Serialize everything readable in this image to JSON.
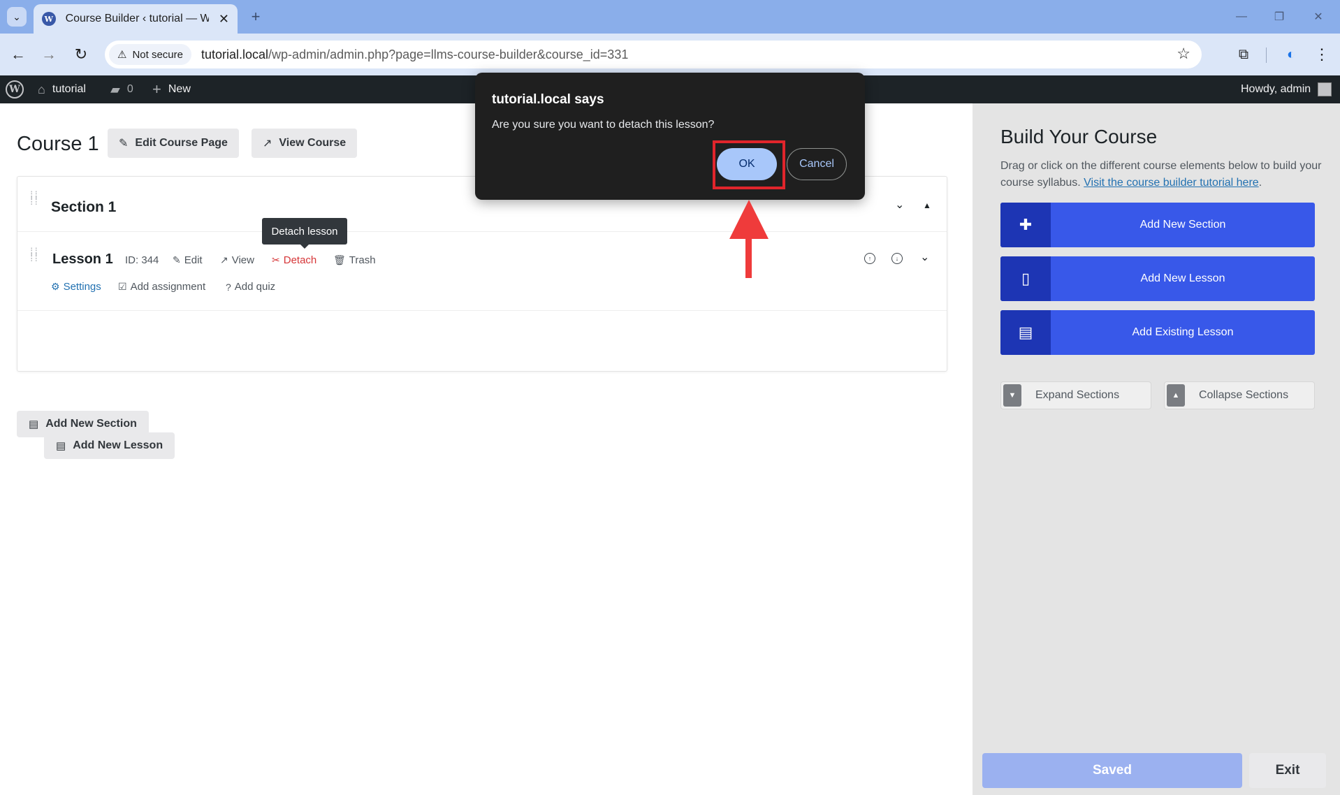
{
  "browser": {
    "tab_title": "Course Builder ‹ tutorial — Wor",
    "security_label": "Not secure",
    "url_host": "tutorial.local",
    "url_path": "/wp-admin/admin.php?page=llms-course-builder&course_id=331"
  },
  "adminbar": {
    "site_name": "tutorial",
    "comments_count": "0",
    "new_label": "New",
    "greeting": "Howdy, admin"
  },
  "course": {
    "title": "Course 1",
    "edit_page_label": "Edit Course Page",
    "view_course_label": "View Course"
  },
  "section": {
    "title": "Section 1",
    "lesson": {
      "title": "Lesson 1",
      "id_text": "ID: 344",
      "edit_label": "Edit",
      "view_label": "View",
      "detach_label": "Detach",
      "trash_label": "Trash",
      "settings_label": "Settings",
      "assignment_label": "Add assignment",
      "quiz_label": "Add quiz"
    },
    "add_lesson_label": "Add New Lesson"
  },
  "tooltip": "Detach lesson",
  "add_section_label": "Add New Section",
  "sidebar": {
    "title": "Build Your Course",
    "description": "Drag or click on the different course elements below to build your course syllabus. ",
    "tutorial_link": "Visit the course builder tutorial here",
    "description_end": ".",
    "buttons": [
      {
        "label": "Add New Section",
        "icon": "puzzle-icon"
      },
      {
        "label": "Add New Lesson",
        "icon": "file-icon"
      },
      {
        "label": "Add Existing Lesson",
        "icon": "file-text-icon"
      }
    ],
    "expand_label": "Expand Sections",
    "collapse_label": "Collapse Sections",
    "saved_label": "Saved",
    "exit_label": "Exit"
  },
  "dialog": {
    "title": "tutorial.local says",
    "message": "Are you sure you want to detach this lesson?",
    "ok_label": "OK",
    "cancel_label": "Cancel"
  },
  "colors": {
    "accent": "#3858e9",
    "accent_dark": "#1d35b4",
    "annotation": "#e0252b",
    "detach": "#d63638"
  }
}
